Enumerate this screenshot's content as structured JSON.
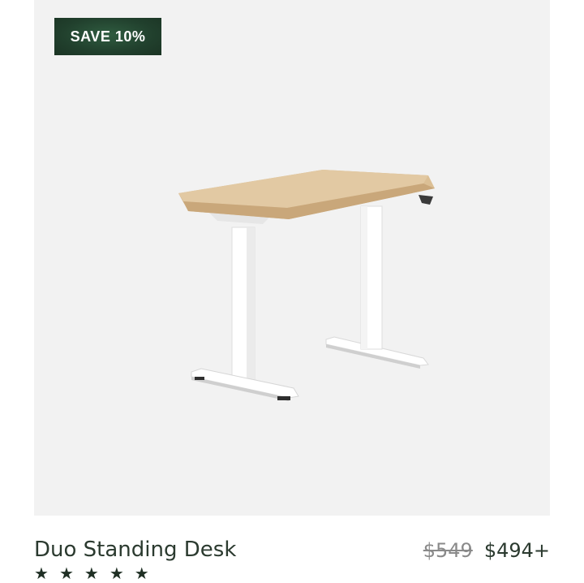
{
  "product": {
    "badge": "SAVE 10%",
    "title": "Duo Standing Desk",
    "price_original": "$549",
    "price_sale": "$494+",
    "rating_stars": 5,
    "image_icon": "standing-desk-image"
  },
  "colors": {
    "badge_bg": "#21402d",
    "image_bg": "#f2f2f2",
    "title": "#2b3a2f",
    "strike_price": "#8a8a8a"
  }
}
